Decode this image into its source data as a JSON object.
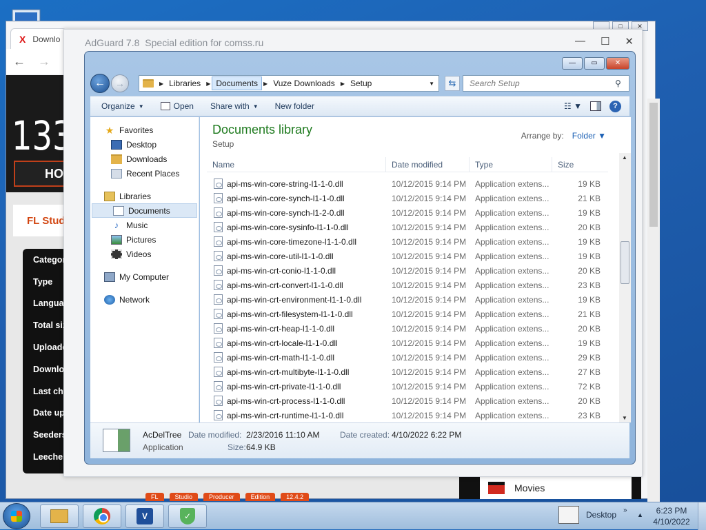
{
  "browser": {
    "tab_label": "Downlo",
    "caption_buttons": [
      "_",
      "□",
      "✕"
    ]
  },
  "site": {
    "big_text": "133",
    "home_text": "HO",
    "fl_text": "FL Studi",
    "rows": [
      "Categor",
      "Type",
      "Langua",
      "Total siz",
      "Uploade",
      "Downlo",
      "Last che",
      "Date up",
      "Seeders",
      "Leeche"
    ],
    "tags": [
      "FL",
      "Studio",
      "Producer",
      "Edition",
      "12.4.2"
    ],
    "movies_label": "Movies"
  },
  "adguard": {
    "title": "AdGuard 7.8",
    "subtitle": "Special edition for comss.ru",
    "controls": [
      "—",
      "☐",
      "✕"
    ]
  },
  "explorer": {
    "window_controls": [
      "—",
      "▭",
      "✕"
    ],
    "breadcrumb": [
      "Libraries",
      "Documents",
      "Vuze Downloads",
      "Setup"
    ],
    "search_placeholder": "Search Setup",
    "toolbar": {
      "organize": "Organize",
      "open": "Open",
      "share_with": "Share with",
      "new_folder": "New folder"
    },
    "nav": {
      "favorites": "Favorites",
      "desktop": "Desktop",
      "downloads": "Downloads",
      "recent": "Recent Places",
      "libraries": "Libraries",
      "documents": "Documents",
      "music": "Music",
      "pictures": "Pictures",
      "videos": "Videos",
      "computer": "My Computer",
      "network": "Network"
    },
    "content": {
      "title": "Documents library",
      "subtitle": "Setup",
      "arrange_label": "Arrange by:",
      "arrange_value": "Folder",
      "columns": [
        "Name",
        "Date modified",
        "Type",
        "Size"
      ]
    },
    "files": [
      {
        "name": "api-ms-win-core-string-l1-1-0.dll",
        "date": "10/12/2015 9:14 PM",
        "type": "Application extens...",
        "size": "19 KB"
      },
      {
        "name": "api-ms-win-core-synch-l1-1-0.dll",
        "date": "10/12/2015 9:14 PM",
        "type": "Application extens...",
        "size": "21 KB"
      },
      {
        "name": "api-ms-win-core-synch-l1-2-0.dll",
        "date": "10/12/2015 9:14 PM",
        "type": "Application extens...",
        "size": "19 KB"
      },
      {
        "name": "api-ms-win-core-sysinfo-l1-1-0.dll",
        "date": "10/12/2015 9:14 PM",
        "type": "Application extens...",
        "size": "20 KB"
      },
      {
        "name": "api-ms-win-core-timezone-l1-1-0.dll",
        "date": "10/12/2015 9:14 PM",
        "type": "Application extens...",
        "size": "19 KB"
      },
      {
        "name": "api-ms-win-core-util-l1-1-0.dll",
        "date": "10/12/2015 9:14 PM",
        "type": "Application extens...",
        "size": "19 KB"
      },
      {
        "name": "api-ms-win-crt-conio-l1-1-0.dll",
        "date": "10/12/2015 9:14 PM",
        "type": "Application extens...",
        "size": "20 KB"
      },
      {
        "name": "api-ms-win-crt-convert-l1-1-0.dll",
        "date": "10/12/2015 9:14 PM",
        "type": "Application extens...",
        "size": "23 KB"
      },
      {
        "name": "api-ms-win-crt-environment-l1-1-0.dll",
        "date": "10/12/2015 9:14 PM",
        "type": "Application extens...",
        "size": "19 KB"
      },
      {
        "name": "api-ms-win-crt-filesystem-l1-1-0.dll",
        "date": "10/12/2015 9:14 PM",
        "type": "Application extens...",
        "size": "21 KB"
      },
      {
        "name": "api-ms-win-crt-heap-l1-1-0.dll",
        "date": "10/12/2015 9:14 PM",
        "type": "Application extens...",
        "size": "20 KB"
      },
      {
        "name": "api-ms-win-crt-locale-l1-1-0.dll",
        "date": "10/12/2015 9:14 PM",
        "type": "Application extens...",
        "size": "19 KB"
      },
      {
        "name": "api-ms-win-crt-math-l1-1-0.dll",
        "date": "10/12/2015 9:14 PM",
        "type": "Application extens...",
        "size": "29 KB"
      },
      {
        "name": "api-ms-win-crt-multibyte-l1-1-0.dll",
        "date": "10/12/2015 9:14 PM",
        "type": "Application extens...",
        "size": "27 KB"
      },
      {
        "name": "api-ms-win-crt-private-l1-1-0.dll",
        "date": "10/12/2015 9:14 PM",
        "type": "Application extens...",
        "size": "72 KB"
      },
      {
        "name": "api-ms-win-crt-process-l1-1-0.dll",
        "date": "10/12/2015 9:14 PM",
        "type": "Application extens...",
        "size": "20 KB"
      },
      {
        "name": "api-ms-win-crt-runtime-l1-1-0.dll",
        "date": "10/12/2015 9:14 PM",
        "type": "Application extens...",
        "size": "23 KB"
      }
    ],
    "details": {
      "name": "AcDelTree",
      "kind": "Application",
      "date_modified_label": "Date modified:",
      "date_modified": "2/23/2016 11:10 AM",
      "date_created_label": "Date created:",
      "date_created": "4/10/2022 6:22 PM",
      "size_label": "Size:",
      "size": "64.9 KB"
    }
  },
  "taskbar": {
    "desktop_label": "Desktop",
    "time": "6:23 PM",
    "date": "4/10/2022"
  }
}
